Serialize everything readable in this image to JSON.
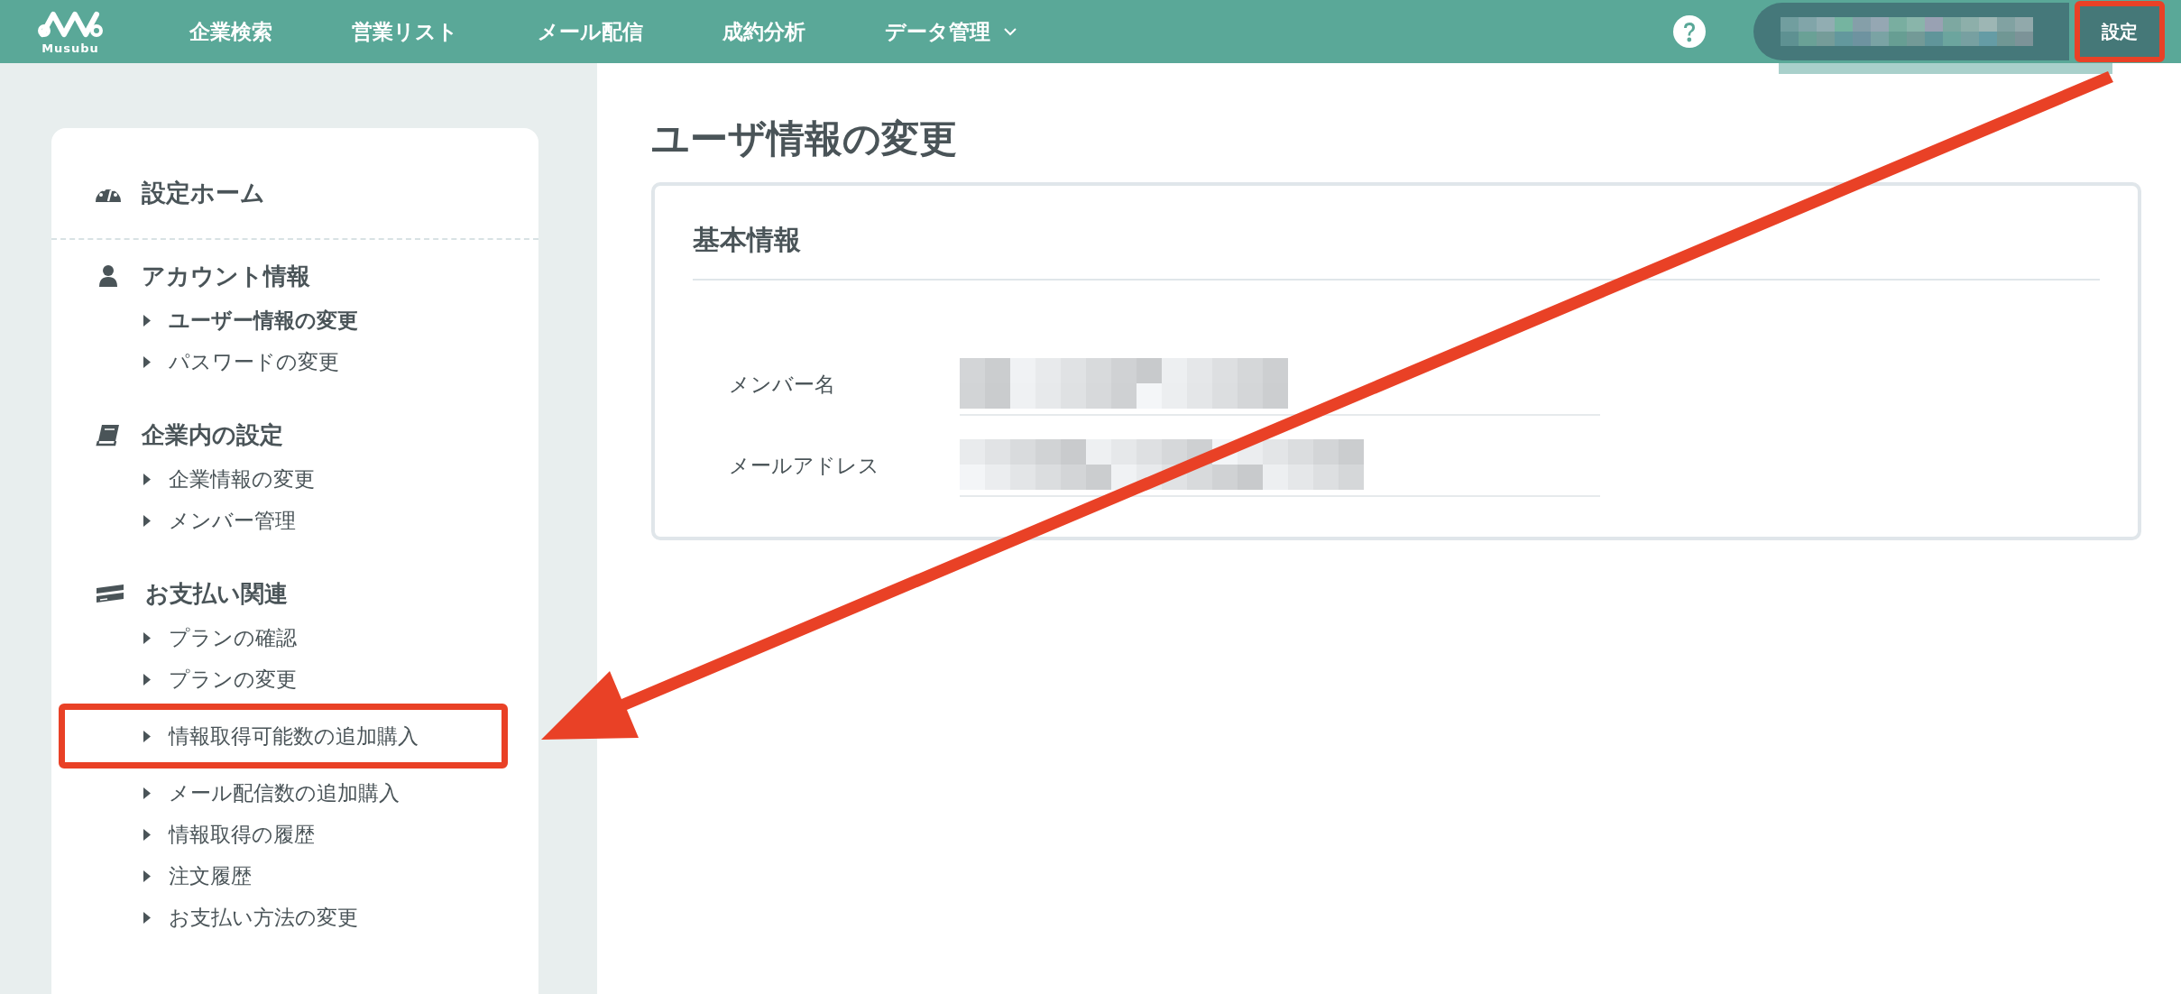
{
  "header": {
    "logo": {
      "text": "Musubu"
    },
    "nav": [
      {
        "label": "企業検索",
        "dropdown": false
      },
      {
        "label": "営業リスト",
        "dropdown": false
      },
      {
        "label": "メール配信",
        "dropdown": false
      },
      {
        "label": "成約分析",
        "dropdown": false
      },
      {
        "label": "データ管理",
        "dropdown": true
      }
    ],
    "settings_button": {
      "label": "設定",
      "highlighted": true
    }
  },
  "sidebar": {
    "home": {
      "label": "設定ホーム"
    },
    "sections": [
      {
        "kind": "account",
        "title": "アカウント情報",
        "items": [
          {
            "label": "ユーザー情報の変更",
            "selected": true,
            "highlighted": false
          },
          {
            "label": "パスワードの変更",
            "selected": false,
            "highlighted": false
          }
        ]
      },
      {
        "kind": "company",
        "title": "企業内の設定",
        "items": [
          {
            "label": "企業情報の変更",
            "selected": false,
            "highlighted": false
          },
          {
            "label": "メンバー管理",
            "selected": false,
            "highlighted": false
          }
        ]
      },
      {
        "kind": "payment",
        "title": "お支払い関連",
        "items": [
          {
            "label": "プランの確認",
            "selected": false,
            "highlighted": false
          },
          {
            "label": "プランの変更",
            "selected": false,
            "highlighted": false
          },
          {
            "label": "情報取得可能数の追加購入",
            "selected": false,
            "highlighted": true
          },
          {
            "label": "メール配信数の追加購入",
            "selected": false,
            "highlighted": false
          },
          {
            "label": "情報取得の履歴",
            "selected": false,
            "highlighted": false
          },
          {
            "label": "注文履歴",
            "selected": false,
            "highlighted": false
          },
          {
            "label": "お支払い方法の変更",
            "selected": false,
            "highlighted": false
          }
        ]
      }
    ]
  },
  "main": {
    "title": "ユーザ情報の変更",
    "card": {
      "title": "基本情報",
      "fields": [
        {
          "label": "メンバー名"
        },
        {
          "label": "メールアドレス"
        }
      ]
    }
  }
}
